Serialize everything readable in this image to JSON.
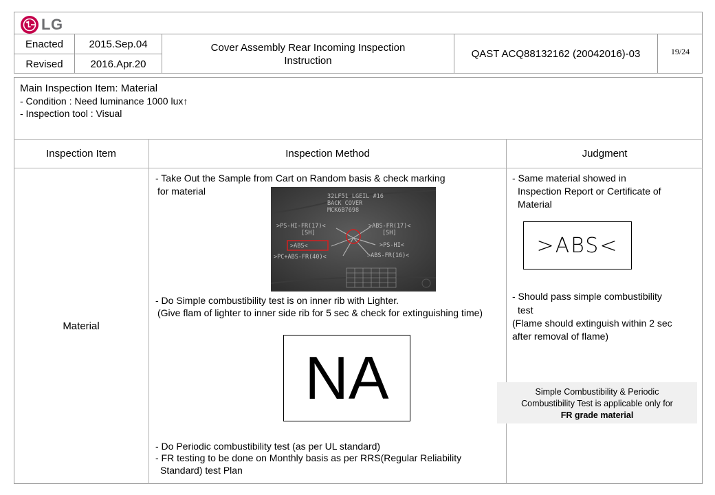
{
  "logo": {
    "text": "LG"
  },
  "header": {
    "enacted_label": "Enacted",
    "enacted_date": "2015.Sep.04",
    "revised_label": "Revised",
    "revised_date": "2016.Apr.20",
    "title_line1": "Cover Assembly Rear Incoming Inspection",
    "title_line2": "Instruction",
    "doc_number": "QAST ACQ88132162 (20042016)-03",
    "page": "19/24"
  },
  "summary": {
    "main_item": "Main Inspection Item: Material",
    "condition": "- Condition : Need luminance 1000 lux↑",
    "tool": "- Inspection tool : Visual"
  },
  "table": {
    "headers": [
      "Inspection Item",
      "Inspection Method",
      "Judgment"
    ],
    "item": "Material",
    "method": {
      "step1_line1": "- Take Out the Sample from Cart on Random basis & check marking",
      "step1_line2": "for material",
      "step2_line1": "- Do Simple combustibility test is on inner rib  with Lighter.",
      "step2_line2": "(Give flam of lighter to inner side rib for 5 sec & check for extinguishing time)",
      "na_text": "NA",
      "step3_line1": "- Do Periodic combustibility test (as per UL standard)",
      "step4_line1": "- FR testing to be done on Monthly basis as per RRS(Regular Reliability",
      "step4_line2": "Standard) test Plan"
    },
    "judgment": {
      "j1_line1": "- Same material showed in",
      "j1_line2": "Inspection Report or Certificate of",
      "j1_line3": "Material",
      "abs_marking": ">ABS<",
      "j2_line1": "- Should pass simple combustibility",
      "j2_line2": "test",
      "j2_line3": "(Flame should extinguish within 2 sec",
      "j2_line4": "after removal of flame)",
      "note_line1": "Simple Combustibility & Periodic",
      "note_line2": "Combustibility Test is applicable  only for",
      "note_line3": "FR grade material"
    }
  },
  "photo": {
    "lines": [
      "32LF51 LGEIL #16",
      "BACK COVER",
      "MCK6B7698"
    ],
    "label_ps_hi_fr": ">PS-HI-FR(17)<",
    "label_sh_left": "[SH]",
    "label_abs_fr": ">ABS-FR(17)<",
    "label_sh_right": "[SH]",
    "label_abs": ">ABS<",
    "label_ps_hi": ">PS-HI<",
    "label_pc_abs": ">PC+ABS-FR(40)<",
    "label_abs_fr16": ">ABS-FR(16)<",
    "highlight_color": "#d42020"
  }
}
